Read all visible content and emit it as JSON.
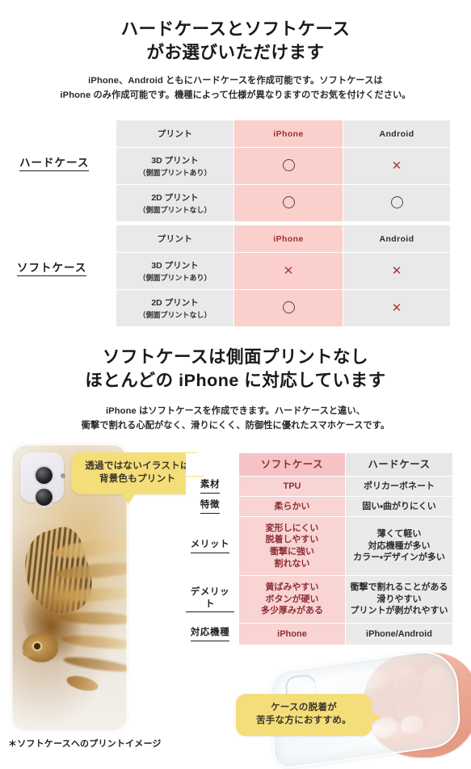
{
  "section1": {
    "title_line1": "ハードケースとソフトケース",
    "title_line2": "がお選びいただけます",
    "lead_line1": "iPhone、Android ともにハードケースを作成可能です。ソフトケースは",
    "lead_line2": "iPhone のみ作成可能です。機種によって仕様が異なりますのでお気を付けください。",
    "hard_label": "ハードケース",
    "soft_label": "ソフトケース",
    "columns": [
      "プリント",
      "iPhone",
      "Android"
    ],
    "rows_hard": [
      {
        "name": "3D プリント",
        "sub": "（側面プリントあり）",
        "iphone": "○",
        "android": "×"
      },
      {
        "name": "2D プリント",
        "sub": "（側面プリントなし）",
        "iphone": "○",
        "android": "○"
      }
    ],
    "rows_soft": [
      {
        "name": "3D プリント",
        "sub": "（側面プリントあり）",
        "iphone": "×",
        "android": "×"
      },
      {
        "name": "2D プリント",
        "sub": "（側面プリントなし）",
        "iphone": "○",
        "android": "×"
      }
    ]
  },
  "section2": {
    "title_line1": "ソフトケースは側面プリントなし",
    "title_line2": "ほとんどの iPhone に対応しています",
    "lead_line1": "iPhone はソフトケースを作成できます。ハードケースと違い、",
    "lead_line2": "衝撃で割れる心配がなく、滑りにくく、防御性に優れたスマホケースです。"
  },
  "bubbles": {
    "illust_line1": "透過ではないイラストは",
    "illust_line2": "背景色もプリント",
    "tpu_line1": "ケースの脱着が",
    "tpu_line2": "苦手な方におすすめ。"
  },
  "comparison": {
    "header_soft": "ソフトケース",
    "header_hard": "ハードケース",
    "rows": [
      {
        "label": "素材",
        "soft": "TPU",
        "hard": "ポリカーボネート"
      },
      {
        "label": "特徴",
        "soft": "柔らかい",
        "hard": "固い・曲がりにくい"
      },
      {
        "label": "メリット",
        "soft_lines": [
          "変形しにくい",
          "脱着しやすい",
          "衝撃に強い",
          "割れない"
        ],
        "hard_lines": [
          "薄くて軽い",
          "対応機種が多い",
          "カラー・デザインが多い"
        ]
      },
      {
        "label": "デメリット",
        "soft_lines": [
          "黄ばみやすい",
          "ボタンが硬い",
          "多少厚みがある"
        ],
        "hard_lines": [
          "衝撃で割れることがある",
          "滑りやすい",
          "プリントが剥がれやすい"
        ]
      },
      {
        "label": "対応機種",
        "soft": "iPhone",
        "hard": "iPhone/Android"
      }
    ]
  },
  "footnote": "＊ソフトケースへのプリントイメージ",
  "colors": {
    "pink_cell": "#fbcfcb",
    "pink_header": "#f6c3c4",
    "pink_body": "#f8d4d3",
    "gray_cell": "#e9e9e9",
    "bubble_yellow": "#f4de7a",
    "cross_red": "#a33b3b",
    "text_dark": "#231f20"
  }
}
